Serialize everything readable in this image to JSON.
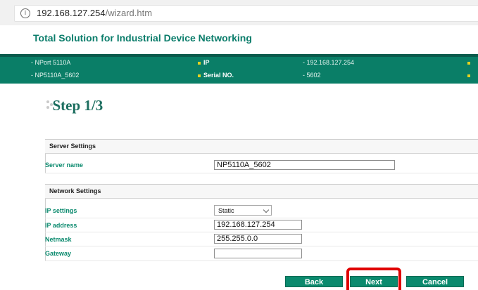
{
  "browser": {
    "info_icon": "info-icon",
    "url_host": "192.168.127.254",
    "url_path": "/wizard.htm"
  },
  "header": {
    "tagline": "Total Solution for Industrial Device Networking"
  },
  "info_bar": {
    "model": "- NPort 5110A",
    "name": "- NP5110A_5602",
    "ip_label": "IP",
    "ip_value": "- 192.168.127.254",
    "serial_label": "Serial NO.",
    "serial_value": "- 5602",
    "bullet_color": "#e6d21f",
    "bar_color": "#0a7e67"
  },
  "step": {
    "title": "Step 1/3"
  },
  "server_settings": {
    "heading": "Server Settings",
    "server_name_label": "Server name",
    "server_name_value": "NP5110A_5602"
  },
  "network_settings": {
    "heading": "Network Settings",
    "ip_settings_label": "IP settings",
    "ip_settings_value": "Static",
    "ip_address_label": "IP address",
    "ip_address_value": "192.168.127.254",
    "netmask_label": "Netmask",
    "netmask_value": "255.255.0.0",
    "gateway_label": "Gateway",
    "gateway_value": ""
  },
  "buttons": {
    "back": "Back",
    "next": "Next",
    "cancel": "Cancel",
    "highlight_color": "#e00000"
  }
}
